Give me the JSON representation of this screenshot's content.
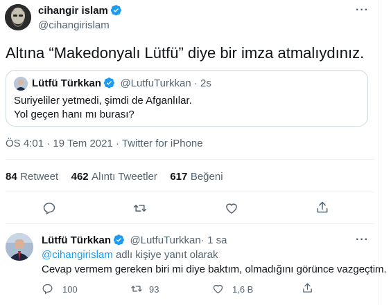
{
  "tweet": {
    "author_name": "cihangir islam",
    "author_handle": "@cihangirislam",
    "text": "Altına “Makedonyalı Lütfü” diye bir imza atmalıydınız.",
    "quoted": {
      "author_name": "Lütfü Türkkan",
      "author_handle": "@LutfuTurkkan",
      "time": "2s",
      "line1": "Suriyeliler yetmedi, şimdi de Afganlılar.",
      "line2": "Yol geçen hanı mı burası?"
    },
    "timestamp": "ÖS 4:01 · 19 Tem 2021 · Twitter for iPhone",
    "stats": {
      "retweets_num": "84",
      "retweets_label": "Retweet",
      "quotes_num": "462",
      "quotes_label": "Alıntı Tweetler",
      "likes_num": "617",
      "likes_label": "Beğeni"
    }
  },
  "reply": {
    "author_name": "Lütfü Türkkan",
    "author_handle": "@LutfuTurkkan",
    "time": "1 sa",
    "dot": "·",
    "replying_handle": "@cihangirislam",
    "replying_suffix": "adlı kişiye yanıt olarak",
    "text": "Cevap vermem gereken biri mi diye baktım, olmadığını görünce vazgeçtim.",
    "reply_count": "100",
    "retweet_count": "93",
    "like_count": "1,6 B"
  },
  "colors": {
    "verified": "#1d9bf0",
    "text_secondary": "#536471",
    "accent": "#1d9bf0"
  },
  "icons": [
    "verified-badge-icon",
    "more-icon",
    "reply-icon",
    "retweet-icon",
    "like-icon",
    "share-icon"
  ]
}
